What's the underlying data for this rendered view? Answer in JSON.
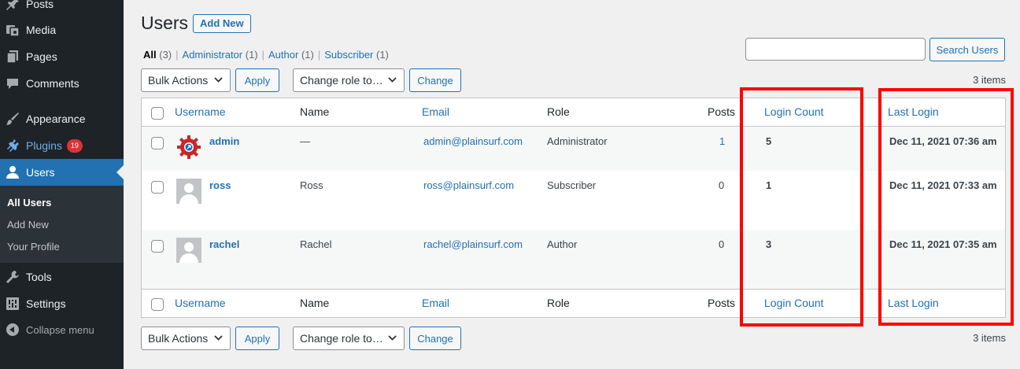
{
  "sidebar": {
    "posts": "Posts",
    "media": "Media",
    "pages": "Pages",
    "comments": "Comments",
    "appearance": "Appearance",
    "plugins": "Plugins",
    "plugins_badge": "19",
    "users": "Users",
    "submenu": [
      "All Users",
      "Add New",
      "Your Profile"
    ],
    "tools": "Tools",
    "settings": "Settings",
    "collapse": "Collapse menu"
  },
  "header": {
    "title": "Users",
    "add_new": "Add New"
  },
  "filters": {
    "all_label": "All",
    "all_count": "(3)",
    "administrator_label": "Administrator",
    "administrator_count": "(1)",
    "author_label": "Author",
    "author_count": "(1)",
    "subscriber_label": "Subscriber",
    "subscriber_count": "(1)"
  },
  "search": {
    "button": "Search Users",
    "value": ""
  },
  "actions": {
    "bulk": "Bulk Actions",
    "apply": "Apply",
    "change_role": "Change role to…",
    "change": "Change",
    "items": "3 items"
  },
  "table": {
    "columns": [
      "Username",
      "Name",
      "Email",
      "Role",
      "Posts",
      "Login Count",
      "Last Login"
    ],
    "rows": [
      {
        "username": "admin",
        "name": "—",
        "email": "admin@plainsurf.com",
        "role": "Administrator",
        "posts": "1",
        "login_count": "5",
        "last_login": "Dec 11, 2021 07:36 am"
      },
      {
        "username": "ross",
        "name": "Ross",
        "email": "ross@plainsurf.com",
        "role": "Subscriber",
        "posts": "0",
        "login_count": "1",
        "last_login": "Dec 11, 2021 07:33 am"
      },
      {
        "username": "rachel",
        "name": "Rachel",
        "email": "rachel@plainsurf.com",
        "role": "Author",
        "posts": "0",
        "login_count": "3",
        "last_login": "Dec 11, 2021 07:35 am"
      }
    ]
  },
  "colors": {
    "highlight": "#ff0000",
    "accent": "#2271b1",
    "sidebar": "#1d2327"
  }
}
